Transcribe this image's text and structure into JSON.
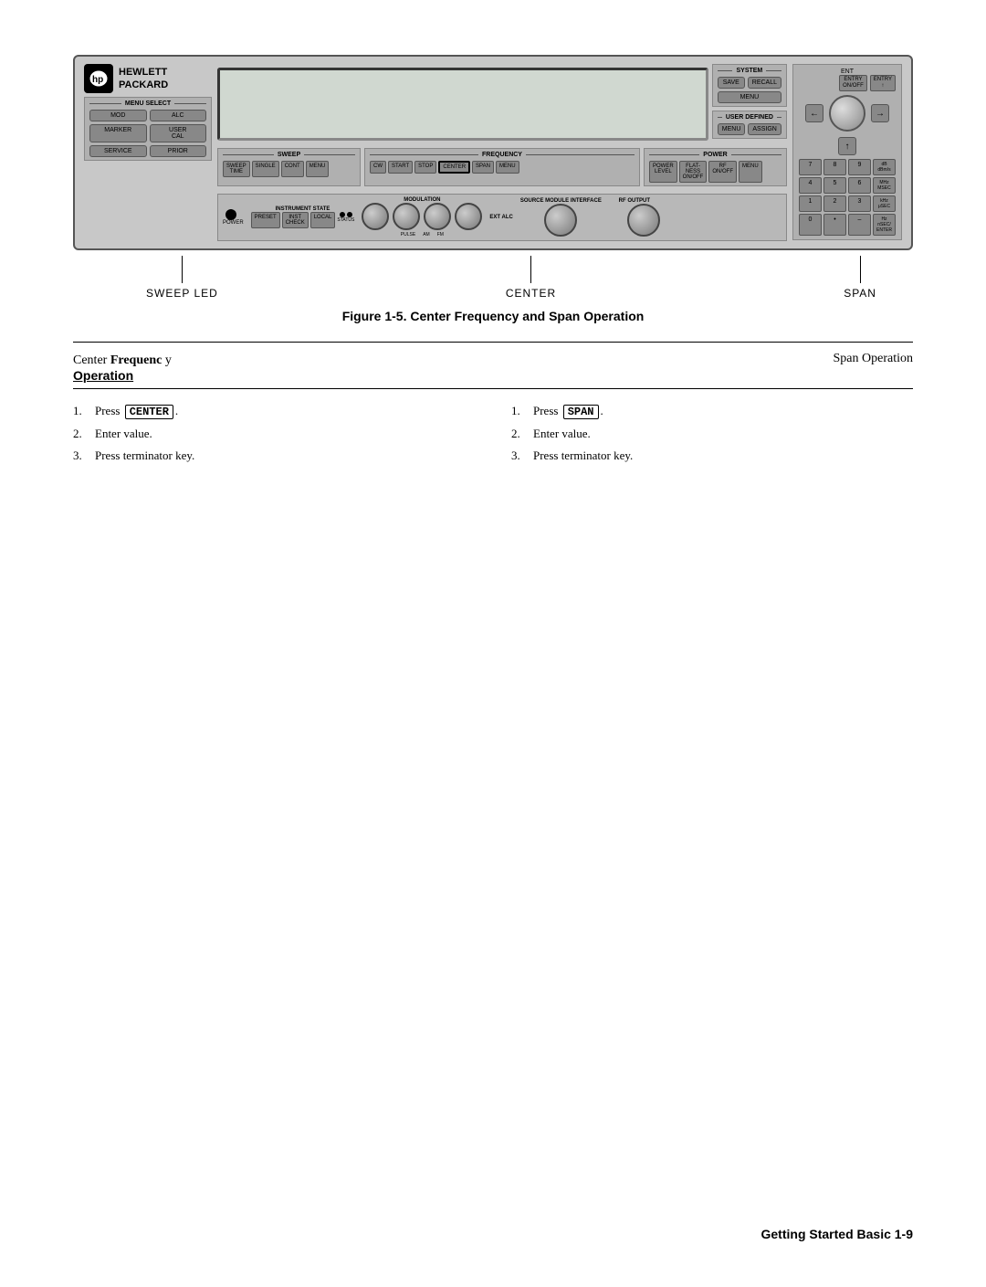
{
  "page": {
    "title": "Getting Started Basic 1-9"
  },
  "figure": {
    "number": "Figure 1-5.",
    "title": "Center Frequency and Span Operation"
  },
  "instrument": {
    "brand": "HEWLETT\nPACKARD",
    "logo": "hp",
    "panels": {
      "menu_select": {
        "label": "MENU SELECT",
        "buttons": [
          {
            "id": "mod",
            "label": "MOD"
          },
          {
            "id": "alc",
            "label": "ALC"
          },
          {
            "id": "marker",
            "label": "MARKER"
          },
          {
            "id": "user_cal",
            "label": "USER CAL"
          },
          {
            "id": "service",
            "label": "SERVICE"
          },
          {
            "id": "prior",
            "label": "PRIOR"
          }
        ]
      },
      "system": {
        "label": "SYSTEM",
        "buttons": [
          {
            "id": "save",
            "label": "SAVE"
          },
          {
            "id": "recall",
            "label": "RECALL"
          },
          {
            "id": "menu",
            "label": "MENU"
          }
        ]
      },
      "user_defined": {
        "label": "USER DEFINED",
        "buttons": [
          {
            "id": "menu2",
            "label": "MENU"
          },
          {
            "id": "assign",
            "label": "ASSIGN"
          }
        ]
      },
      "entry": {
        "label": "ENT",
        "buttons": [
          {
            "id": "entry_on_off",
            "label": "ENTRY\nON/OFF"
          },
          {
            "id": "entry_2",
            "label": "ENTRY\n↑"
          },
          {
            "id": "arrow_left",
            "label": "←"
          },
          {
            "id": "arrow_right",
            "label": "→"
          },
          {
            "id": "arrow_up",
            "label": "↑"
          }
        ],
        "numpad": [
          {
            "id": "7",
            "label": "7"
          },
          {
            "id": "8",
            "label": "8"
          },
          {
            "id": "9",
            "label": "9"
          },
          {
            "id": "db_mhz",
            "label": "dB\ndBm/s"
          },
          {
            "id": "4",
            "label": "4"
          },
          {
            "id": "5",
            "label": "5"
          },
          {
            "id": "6",
            "label": "6"
          },
          {
            "id": "mhz_msec",
            "label": "MHz\nMSEC"
          },
          {
            "id": "1",
            "label": "1"
          },
          {
            "id": "2",
            "label": "2"
          },
          {
            "id": "3",
            "label": "3"
          },
          {
            "id": "khz_usec",
            "label": "kHz\nμSEC"
          },
          {
            "id": "0",
            "label": "0"
          },
          {
            "id": "dot",
            "label": "•"
          },
          {
            "id": "minus",
            "label": "–"
          },
          {
            "id": "hz_nsec",
            "label": "Hz\nnSEC/\nENTER"
          }
        ]
      },
      "sweep": {
        "label": "SWEEP",
        "buttons": [
          {
            "id": "sweep_time",
            "label": "SWEEP\nTIME"
          },
          {
            "id": "single",
            "label": "SINGLE"
          },
          {
            "id": "cont",
            "label": "CONT"
          },
          {
            "id": "sweep_menu",
            "label": "MENU"
          }
        ]
      },
      "frequency": {
        "label": "FREQUENCY",
        "buttons": [
          {
            "id": "cw",
            "label": "CW"
          },
          {
            "id": "start",
            "label": "START"
          },
          {
            "id": "stop",
            "label": "STOP"
          },
          {
            "id": "center",
            "label": "CENTER"
          },
          {
            "id": "span",
            "label": "SPAN"
          },
          {
            "id": "freq_menu",
            "label": "MENU"
          }
        ]
      },
      "power": {
        "label": "POWER",
        "buttons": [
          {
            "id": "power_level",
            "label": "POWER\nLEVEL"
          },
          {
            "id": "flatness",
            "label": "FLATNESS\nON/OFF"
          },
          {
            "id": "rf_on_off",
            "label": "RF\nON/OFF"
          },
          {
            "id": "power_menu",
            "label": "MENU"
          }
        ]
      }
    }
  },
  "labels": {
    "sweep_led": "SWEEP  LED",
    "center": "CENTER",
    "span": "SPAN"
  },
  "center_frequency": {
    "heading": "Center Frequenc y",
    "subheading": "Operation",
    "steps": [
      {
        "num": "1.",
        "text": "Press",
        "key": "CENTER",
        "suffix": "."
      },
      {
        "num": "2.",
        "text": "Enter value.",
        "key": null
      },
      {
        "num": "3.",
        "text": "Press terminator key.",
        "key": null
      }
    ]
  },
  "span_operation": {
    "heading": "Span  Operation",
    "steps": [
      {
        "num": "1.",
        "text": "Press",
        "key": "SPAN",
        "suffix": "."
      },
      {
        "num": "2.",
        "text": "Enter value.",
        "key": null
      },
      {
        "num": "3.",
        "text": "Press terminator key.",
        "key": null
      }
    ]
  },
  "footer": {
    "text": "Getting Started Basic 1-9"
  }
}
